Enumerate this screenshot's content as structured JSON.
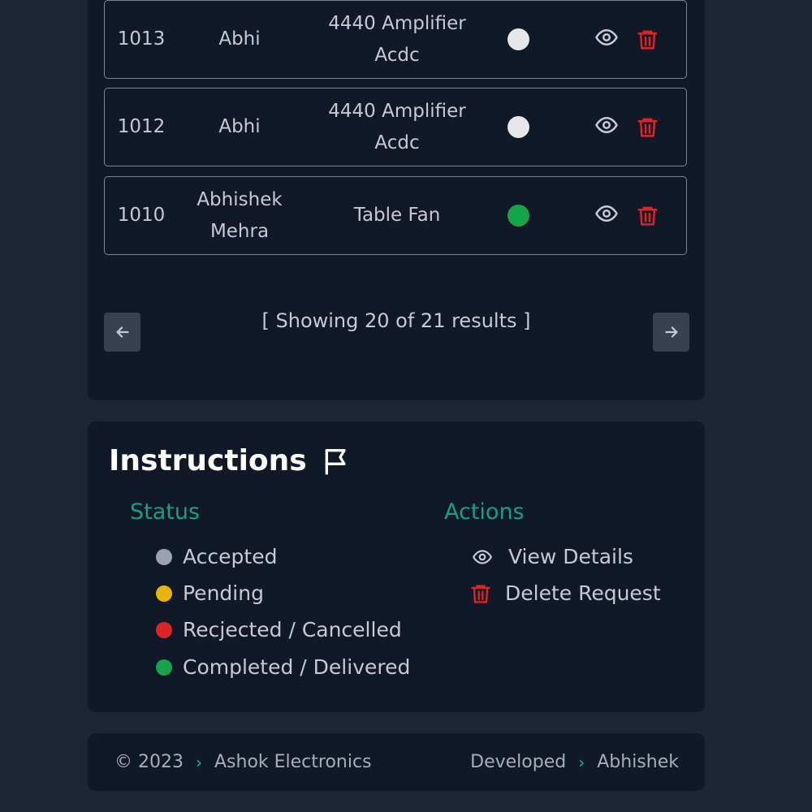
{
  "requests": [
    {
      "id": "1013",
      "name": "Abhi",
      "product": "4440 Amplifier Acdc",
      "status_color": "#e5e7eb"
    },
    {
      "id": "1012",
      "name": "Abhi",
      "product": "4440 Amplifier Acdc",
      "status_color": "#e5e7eb"
    },
    {
      "id": "1010",
      "name": "Abhishek Mehra",
      "product": "Table Fan",
      "status_color": "#16a34a"
    }
  ],
  "pagination": {
    "text": "[ Showing 20 of 21 results ]"
  },
  "instructions": {
    "title": "Instructions",
    "status_heading": "Status",
    "actions_heading": "Actions",
    "statuses": [
      {
        "label": "Accepted",
        "color": "#9ca3af"
      },
      {
        "label": "Pending",
        "color": "#eab308"
      },
      {
        "label": "Recjected / Cancelled",
        "color": "#dc2626"
      },
      {
        "label": "Completed / Delivered",
        "color": "#16a34a"
      }
    ],
    "actions": [
      {
        "label": "View Details",
        "icon": "eye-icon"
      },
      {
        "label": "Delete Request",
        "icon": "trash-icon"
      }
    ]
  },
  "footer": {
    "copyright": "© 2023",
    "company": "Ashok Electronics",
    "developed_label": "Developed",
    "developer": "Abhishek"
  },
  "colors": {
    "background": "#1e2535",
    "panel": "#111827",
    "accent": "#14a085",
    "danger": "#dc2626"
  }
}
